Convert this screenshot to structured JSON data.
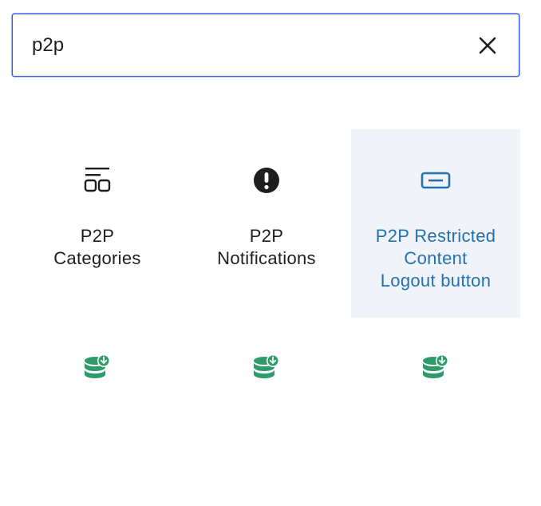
{
  "search": {
    "value": "p2p",
    "clear_label": "Clear search"
  },
  "blocks": [
    {
      "label": "P2P\nCategories",
      "icon": "categories-icon"
    },
    {
      "label": "P2P\nNotifications",
      "icon": "warning-icon"
    },
    {
      "label": "P2P Restricted\nContent\nLogout button",
      "icon": "button-icon"
    },
    {
      "label": "",
      "icon": "database-download-icon"
    },
    {
      "label": "",
      "icon": "database-download-icon"
    },
    {
      "label": "",
      "icon": "database-download-icon"
    }
  ],
  "colors": {
    "accent": "#3858e9",
    "hover_bg": "#f0f4f8",
    "hover_text": "#2271b1",
    "icon_green": "#2e9b6b"
  }
}
